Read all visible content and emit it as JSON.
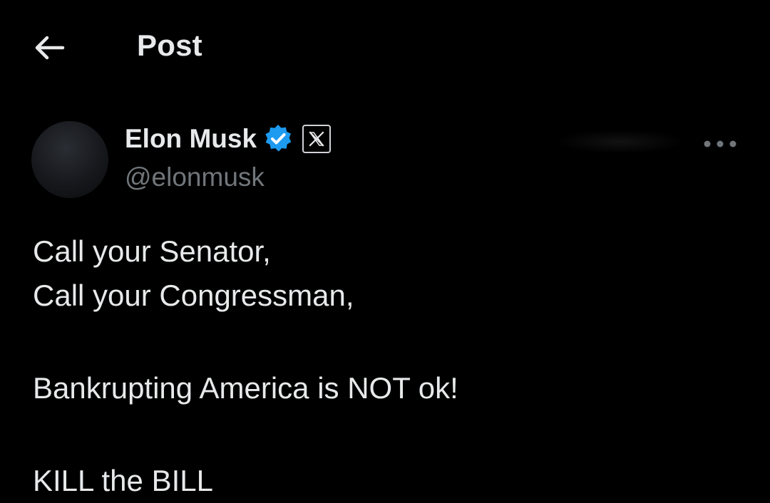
{
  "header": {
    "back_icon": "arrow-left-icon",
    "title": "Post"
  },
  "author": {
    "display_name": "Elon Musk",
    "handle": "@elonmusk",
    "verified_icon": "verified-badge-icon",
    "affiliation_icon": "x-logo-icon",
    "more_icon": "more-horizontal-icon"
  },
  "post": {
    "lines": [
      "Call your Senator,",
      "Call your Congressman,",
      "",
      "Bankrupting America is NOT ok!",
      "",
      "KILL the BILL"
    ]
  },
  "colors": {
    "background": "#000000",
    "text_primary": "#e7e9ea",
    "text_secondary": "#71767b",
    "verified_blue": "#1d9bf0"
  }
}
